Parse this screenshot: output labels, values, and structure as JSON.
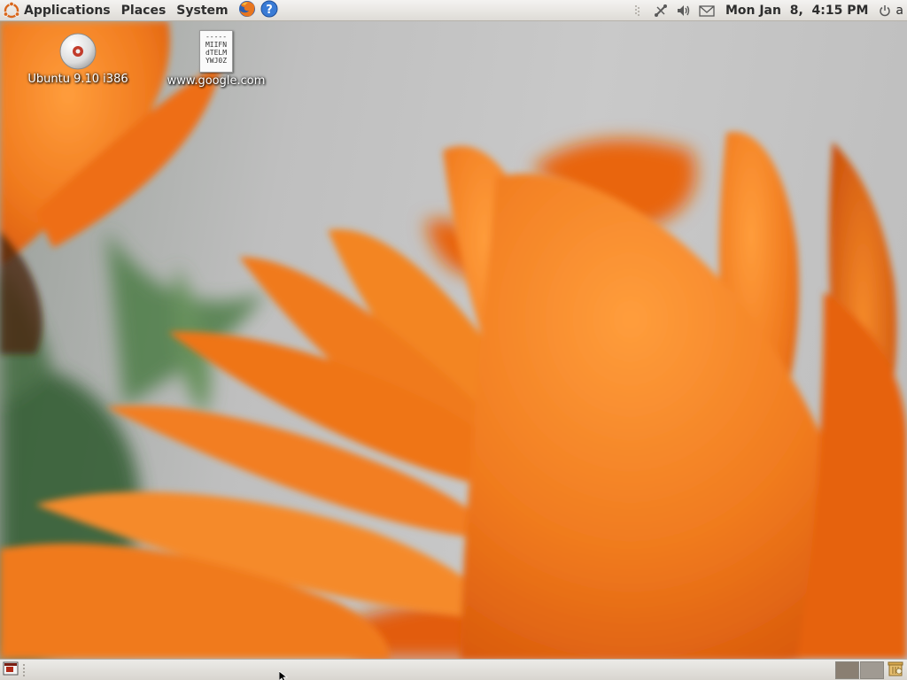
{
  "top_panel": {
    "menus": [
      {
        "label": "Applications",
        "icon": "ubuntu-logo-icon"
      },
      {
        "label": "Places"
      },
      {
        "label": "System"
      }
    ],
    "launchers": [
      {
        "icon": "firefox-icon"
      },
      {
        "icon": "help-icon"
      }
    ],
    "tray_icons": [
      "panel-handle-icon",
      "network-icon",
      "volume-icon",
      "mail-icon"
    ],
    "clock": "Mon Jan  8,  4:15 PM",
    "session": {
      "icon": "power-icon",
      "user_label": "a"
    }
  },
  "desktop": {
    "icons": [
      {
        "name": "Ubuntu 9.10 i386",
        "icon": "cd-disc-icon"
      },
      {
        "name": "www.google.com",
        "icon": "text-file-icon",
        "preview_lines": [
          "-----",
          "MIIFN",
          "dTELM",
          "YWJ0Z"
        ]
      }
    ],
    "wallpaper": "orange-flower"
  },
  "bottom_panel": {
    "show_desktop_icon": "show-desktop-icon",
    "workspaces": [
      {
        "state": "active"
      },
      {
        "state": "inactive"
      }
    ],
    "trash_icon": "trash-icon"
  },
  "colors": {
    "panel_bg": "#dedbd6",
    "flower_orange": "#f07a1e",
    "panel_text": "#2e2e2e"
  }
}
